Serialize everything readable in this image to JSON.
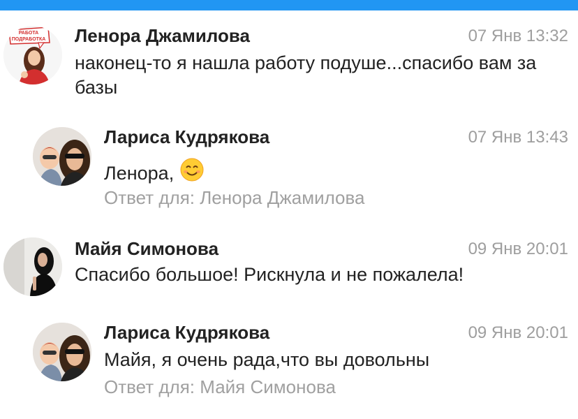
{
  "comments": [
    {
      "author": "Ленора Джамилова",
      "time": "07 Янв 13:32",
      "text": "наконец-то я нашла работу подуше...спасибо вам за базы",
      "avatar_icon": "woman-in-red-avatar",
      "avatar_badge": "РАБОТА ПОДРАБОТКА"
    },
    {
      "author": "Лариса Кудрякова",
      "time": "07 Янв 13:43",
      "text": "Ленора,",
      "emoji": "smiling-face-emoji",
      "reply_to": "Ответ для: Ленора Джамилова",
      "avatar_icon": "woman-with-sunglasses-and-child-avatar"
    },
    {
      "author": "Майя Симонова",
      "time": "09 Янв 20:01",
      "text": "Спасибо большое! Рискнула и не пожалела!",
      "avatar_icon": "woman-in-black-avatar"
    },
    {
      "author": "Лариса Кудрякова",
      "time": "09 Янв 20:01",
      "text": "Майя, я очень рада,что вы довольны",
      "reply_to": "Ответ для: Майя Симонова",
      "avatar_icon": "woman-with-sunglasses-and-child-avatar"
    }
  ],
  "colors": {
    "top_bar": "#2196f3",
    "name": "#222222",
    "time": "#9e9e9e",
    "reply_to": "#a0a0a0"
  }
}
